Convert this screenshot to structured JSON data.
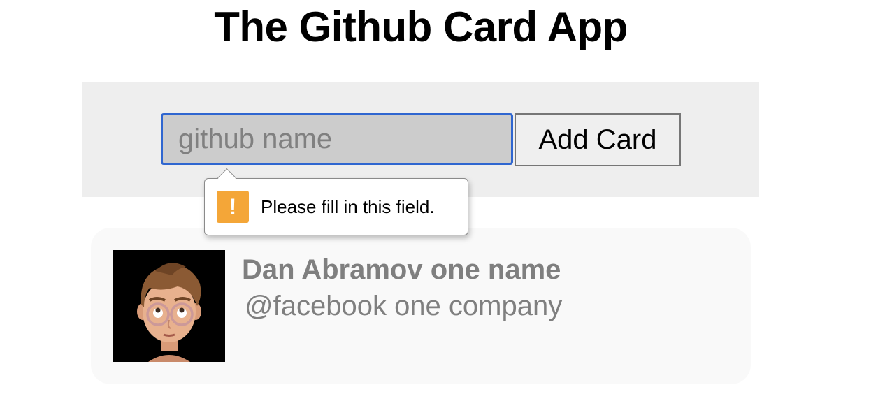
{
  "app": {
    "title": "The Github Card App"
  },
  "form": {
    "input_value": "",
    "input_placeholder": "github name",
    "add_button_label": "Add Card"
  },
  "validation": {
    "message": "Please fill in this field.",
    "icon_glyph": "!",
    "icon": "warning-icon",
    "icon_color": "#f4a638"
  },
  "cards": [
    {
      "name": "Dan Abramov one name",
      "company": "@facebook one company",
      "avatar_icon": "memoji-avatar"
    }
  ],
  "colors": {
    "focus_ring": "#2f66d0",
    "panel_bg": "#eeeeee",
    "card_bg": "#f9f9f9",
    "card_text": "#7f7f7f"
  }
}
